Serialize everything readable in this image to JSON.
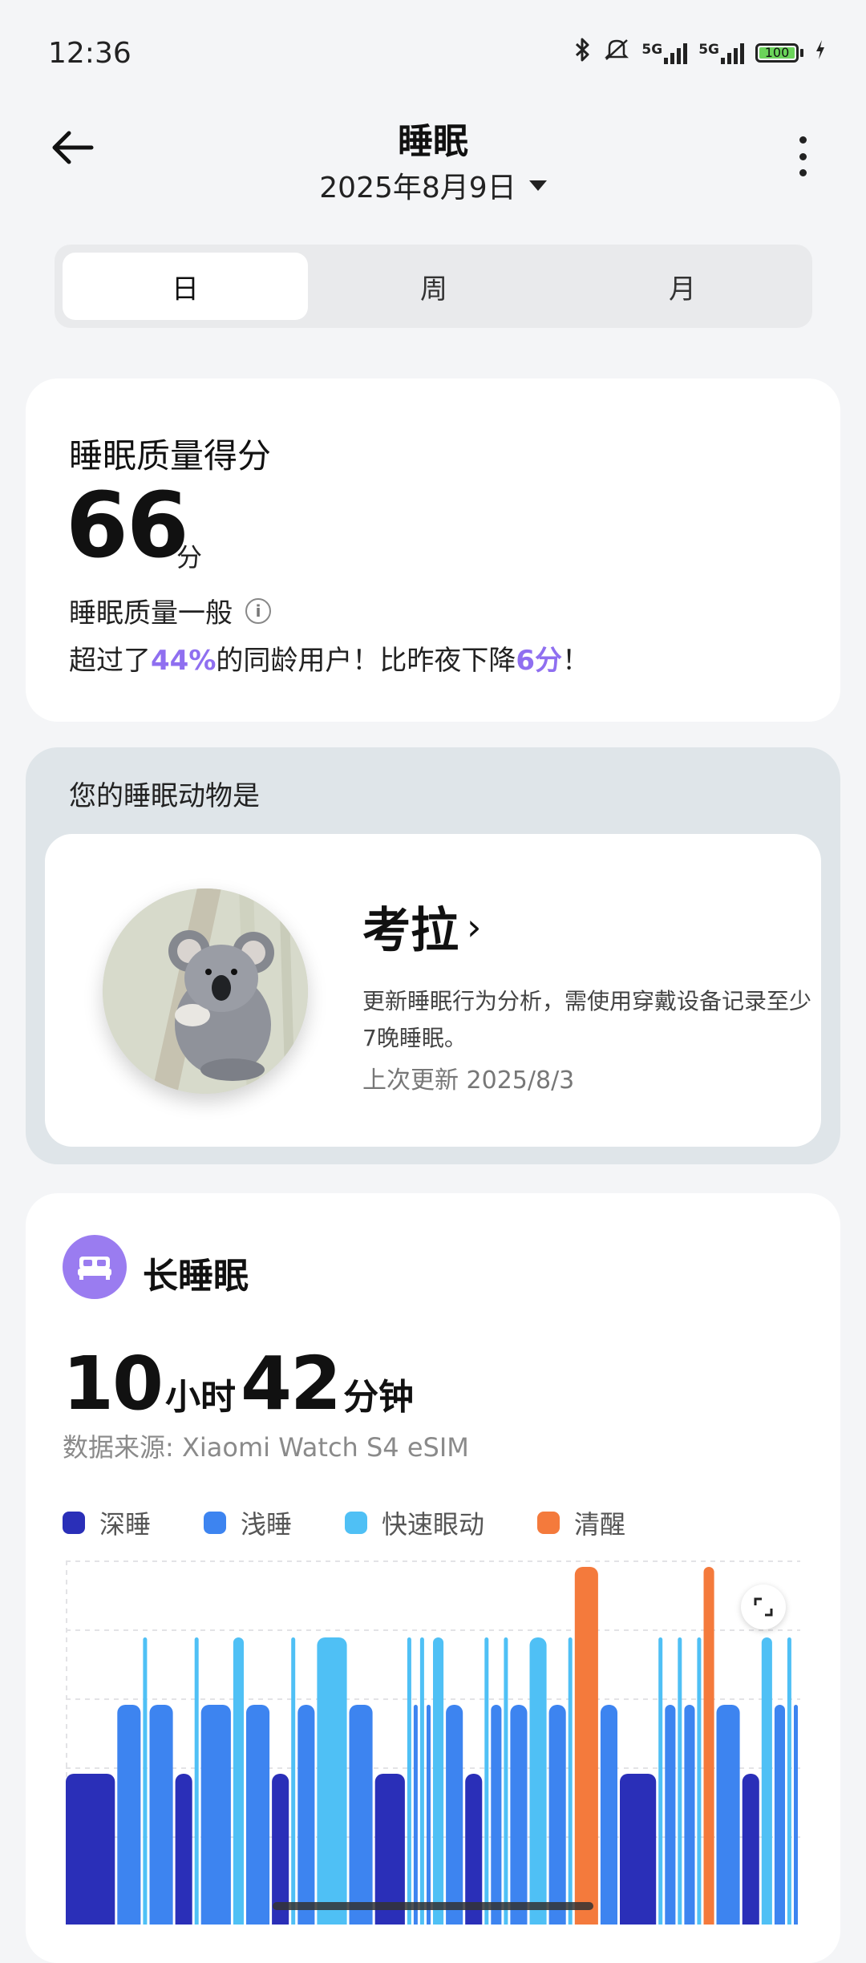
{
  "status_bar": {
    "time": "12:36",
    "net1": "5G",
    "net2": "5G",
    "battery": "100"
  },
  "header": {
    "title": "睡眠",
    "date": "2025年8月9日"
  },
  "tabs": [
    {
      "label": "日",
      "active": true
    },
    {
      "label": "周",
      "active": false
    },
    {
      "label": "月",
      "active": false
    }
  ],
  "score": {
    "label": "睡眠质量得分",
    "value": "66",
    "unit": "分",
    "quality": "睡眠质量一般",
    "compare_prefix": "超过了",
    "compare_pct": "44%",
    "compare_mid": "的同龄用户！比昨夜下降",
    "compare_drop": "6分",
    "compare_suffix": "！"
  },
  "sleep_animal": {
    "heading": "您的睡眠动物是",
    "name": "考拉",
    "description": "更新睡眠行为分析，需使用穿戴设备记录至少7晚睡眠。",
    "updated": "上次更新 2025/8/3",
    "icon": "koala-illustration"
  },
  "sleep": {
    "type": "长睡眠",
    "hours": "10",
    "hours_unit": "小时",
    "minutes": "42",
    "minutes_unit": "分钟",
    "source": "数据来源: Xiaomi Watch S4 eSIM",
    "legend": [
      {
        "label": "深睡",
        "color": "#2a2fb8"
      },
      {
        "label": "浅睡",
        "color": "#3d84f0"
      },
      {
        "label": "快速眼动",
        "color": "#4fc0f5"
      },
      {
        "label": "清醒",
        "color": "#f47a3c"
      }
    ]
  },
  "chart_data": {
    "type": "area",
    "stages": [
      "清醒",
      "快速眼动",
      "浅睡",
      "深睡"
    ],
    "segments": [
      {
        "stage": "深睡",
        "d": 8
      },
      {
        "stage": "浅睡",
        "d": 4
      },
      {
        "stage": "快速眼动",
        "d": 1
      },
      {
        "stage": "浅睡",
        "d": 4
      },
      {
        "stage": "深睡",
        "d": 3
      },
      {
        "stage": "快速眼动",
        "d": 1
      },
      {
        "stage": "浅睡",
        "d": 5
      },
      {
        "stage": "快速眼动",
        "d": 2
      },
      {
        "stage": "浅睡",
        "d": 4
      },
      {
        "stage": "深睡",
        "d": 3
      },
      {
        "stage": "快速眼动",
        "d": 1
      },
      {
        "stage": "浅睡",
        "d": 3
      },
      {
        "stage": "快速眼动",
        "d": 5
      },
      {
        "stage": "浅睡",
        "d": 4
      },
      {
        "stage": "深睡",
        "d": 5
      },
      {
        "stage": "快速眼动",
        "d": 1
      },
      {
        "stage": "浅睡",
        "d": 1
      },
      {
        "stage": "快速眼动",
        "d": 1
      },
      {
        "stage": "浅睡",
        "d": 1
      },
      {
        "stage": "快速眼动",
        "d": 2
      },
      {
        "stage": "浅睡",
        "d": 3
      },
      {
        "stage": "深睡",
        "d": 3
      },
      {
        "stage": "快速眼动",
        "d": 1
      },
      {
        "stage": "浅睡",
        "d": 2
      },
      {
        "stage": "快速眼动",
        "d": 1
      },
      {
        "stage": "浅睡",
        "d": 3
      },
      {
        "stage": "快速眼动",
        "d": 3
      },
      {
        "stage": "浅睡",
        "d": 3
      },
      {
        "stage": "快速眼动",
        "d": 1
      },
      {
        "stage": "清醒",
        "d": 4
      },
      {
        "stage": "浅睡",
        "d": 3
      },
      {
        "stage": "深睡",
        "d": 6
      },
      {
        "stage": "快速眼动",
        "d": 1
      },
      {
        "stage": "浅睡",
        "d": 2
      },
      {
        "stage": "快速眼动",
        "d": 1
      },
      {
        "stage": "浅睡",
        "d": 2
      },
      {
        "stage": "快速眼动",
        "d": 1
      },
      {
        "stage": "清醒",
        "d": 2
      },
      {
        "stage": "浅睡",
        "d": 4
      },
      {
        "stage": "深睡",
        "d": 3
      },
      {
        "stage": "快速眼动",
        "d": 2
      },
      {
        "stage": "浅睡",
        "d": 2
      },
      {
        "stage": "快速眼动",
        "d": 1
      },
      {
        "stage": "浅睡",
        "d": 1
      }
    ],
    "grid": true
  }
}
